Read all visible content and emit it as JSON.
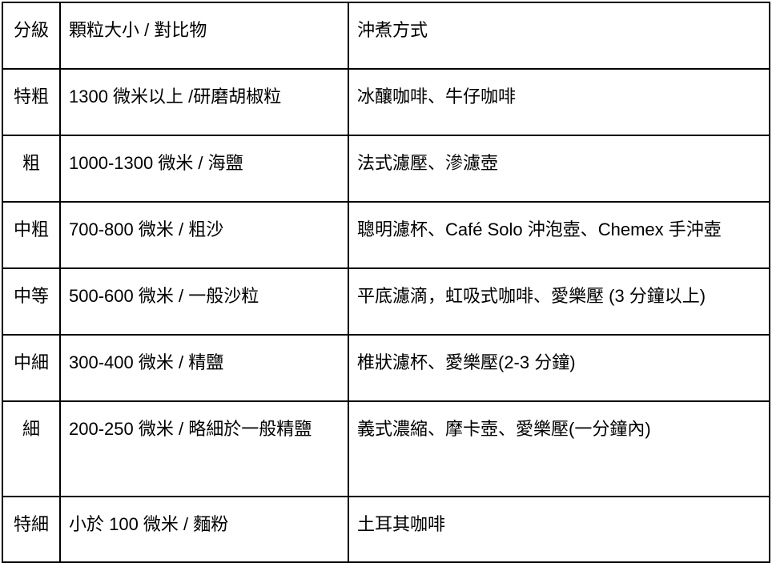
{
  "table": {
    "headers": [
      "分級",
      "顆粒大小 / 對比物",
      "沖煮方式"
    ],
    "rows": [
      [
        "特粗",
        "1300 微米以上 /研磨胡椒粒",
        "冰釀咖啡、牛仔咖啡"
      ],
      [
        "粗",
        "1000-1300 微米 / 海鹽",
        "法式濾壓、滲濾壺"
      ],
      [
        "中粗",
        "700-800 微米 / 粗沙",
        "聰明濾杯、Café Solo 沖泡壺、Chemex 手沖壺"
      ],
      [
        "中等",
        "500-600 微米 / 一般沙粒",
        "平底濾滴，虹吸式咖啡、愛樂壓 (3 分鐘以上)"
      ],
      [
        "中細",
        "300-400 微米 / 精鹽",
        "椎狀濾杯、愛樂壓(2-3 分鐘)"
      ],
      [
        "細",
        "200-250 微米 / 略細於一般精鹽",
        "義式濃縮、摩卡壺、愛樂壓(一分鐘內)"
      ],
      [
        "特細",
        "小於 100 微米 / 麵粉",
        "土耳其咖啡"
      ]
    ]
  }
}
